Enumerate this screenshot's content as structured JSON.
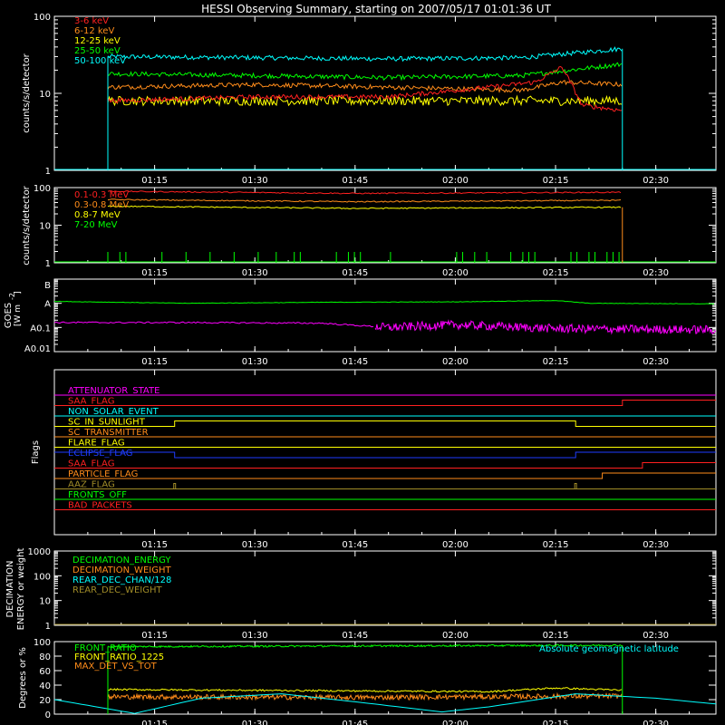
{
  "title": "HESSI Observing Summary, starting on 2007/05/17 01:01:36 UT",
  "time_ticks": [
    "01:15",
    "01:30",
    "01:45",
    "02:00",
    "02:15",
    "02:30"
  ],
  "colors": {
    "background": "#000000",
    "axes": "#ffffff",
    "red": "#ff2020",
    "orange": "#ff8c1a",
    "yellow": "#ffff00",
    "green": "#00ff00",
    "cyan": "#00ffff",
    "magenta": "#ff00ff",
    "blue": "#1e3cff",
    "olive": "#a08c28"
  },
  "chart_data": [
    {
      "type": "line",
      "name": "low-energy-rates",
      "ylabel": "counts/s/detector",
      "yscale": "log",
      "ylim": [
        1,
        100
      ],
      "ytick_labels": [
        "1",
        "10",
        "100"
      ],
      "legend": "top-left",
      "series": [
        {
          "name": "3-6 keV",
          "color": "#ff2020",
          "x": [
            "01:08",
            "01:30",
            "01:50",
            "02:05",
            "02:12",
            "02:16",
            "02:19",
            "02:25"
          ],
          "values": [
            8,
            9,
            9,
            12,
            14,
            22,
            7,
            6
          ]
        },
        {
          "name": "6-12 keV",
          "color": "#ff8c1a",
          "x": [
            "01:08",
            "01:30",
            "01:50",
            "02:10",
            "02:16",
            "02:25"
          ],
          "values": [
            12,
            13,
            12,
            11,
            14,
            13
          ]
        },
        {
          "name": "12-25 keV",
          "color": "#ffff00",
          "x": [
            "01:08",
            "01:30",
            "01:50",
            "02:10",
            "02:25"
          ],
          "values": [
            8,
            8,
            8,
            8,
            8
          ]
        },
        {
          "name": "25-50 keV",
          "color": "#00ff00",
          "x": [
            "01:08",
            "01:30",
            "01:50",
            "02:10",
            "02:25"
          ],
          "values": [
            18,
            17,
            16,
            17,
            24
          ]
        },
        {
          "name": "50-100 keV",
          "color": "#00ffff",
          "x": [
            "01:08",
            "01:30",
            "01:50",
            "02:10",
            "02:25"
          ],
          "values": [
            30,
            29,
            28,
            29,
            38
          ]
        }
      ]
    },
    {
      "type": "line",
      "name": "high-energy-rates",
      "ylabel": "counts/s/detector",
      "yscale": "log",
      "ylim": [
        1,
        100
      ],
      "ytick_labels": [
        "1",
        "10",
        "100"
      ],
      "legend": "top-left",
      "series": [
        {
          "name": "0.1-0.3 MeV",
          "color": "#ff2020",
          "x": [
            "01:08",
            "01:45",
            "02:25"
          ],
          "values": [
            80,
            70,
            75
          ]
        },
        {
          "name": "0.3-0.8 MeV",
          "color": "#ff8c1a",
          "x": [
            "01:08",
            "01:45",
            "02:25"
          ],
          "values": [
            48,
            42,
            46
          ]
        },
        {
          "name": "0.8-7 MeV",
          "color": "#ffff00",
          "x": [
            "01:08",
            "01:45",
            "02:25"
          ],
          "values": [
            32,
            28,
            30
          ]
        },
        {
          "name": "7-20 MeV",
          "color": "#00ff00",
          "x": [
            "01:08",
            "01:45",
            "02:25"
          ],
          "values": [
            1,
            1,
            1
          ]
        }
      ]
    },
    {
      "type": "line",
      "name": "goes",
      "ylabel": "GOES",
      "ylabel_lines": [
        "GOES",
        "[W m",
        "-2",
        "]"
      ],
      "yscale": "log",
      "ylim": [
        1e-09,
        1e-06
      ],
      "ytick_labels": [
        "A0.01",
        "A0.1",
        "A",
        "B"
      ],
      "series": [
        {
          "name": "goes-long",
          "color": "#00ff00",
          "x": [
            "01:00",
            "01:20",
            "01:40",
            "02:00",
            "02:15",
            "02:20",
            "02:39"
          ],
          "values": [
            1.2e-07,
            1e-07,
            1.1e-07,
            1.15e-07,
            1.3e-07,
            1e-07,
            9.5e-08
          ]
        },
        {
          "name": "goes-short",
          "color": "#ff00ff",
          "x": [
            "01:00",
            "01:20",
            "01:40",
            "01:50",
            "02:00",
            "02:15",
            "02:39"
          ],
          "values": [
            1.6e-08,
            1.6e-08,
            1.5e-08,
            1e-08,
            1.3e-08,
            9e-09,
            8e-09
          ]
        }
      ]
    },
    {
      "type": "step",
      "name": "flags",
      "ylabel": "Flags",
      "flags": [
        {
          "name": "ATTENUATOR_STATE",
          "color": "#ff00ff",
          "steps": []
        },
        {
          "name": "SAA_FLAG",
          "color": "#ff2020",
          "steps": [
            [
              "02:25",
              1
            ]
          ]
        },
        {
          "name": "NON_SOLAR_EVENT",
          "color": "#00ffff",
          "steps": []
        },
        {
          "name": "SC_IN_SUNLIGHT",
          "color": "#ffff00",
          "steps": [
            [
              "01:18",
              1
            ],
            [
              "02:18",
              0
            ]
          ]
        },
        {
          "name": "SC_TRANSMITTER",
          "color": "#ff8c1a",
          "steps": []
        },
        {
          "name": "FLARE_FLAG",
          "color": "#ffff00",
          "steps": []
        },
        {
          "name": "ECLIPSE_FLAG",
          "color": "#1e3cff",
          "steps": [
            [
              "01:18",
              0
            ],
            [
              "02:18",
              1
            ]
          ]
        },
        {
          "name": "SAA_FLAG",
          "color": "#ff2020",
          "steps": [
            [
              "02:28",
              1
            ]
          ]
        },
        {
          "name": "PARTICLE_FLAG",
          "color": "#ff8c1a",
          "steps": [
            [
              "02:22",
              1
            ]
          ]
        },
        {
          "name": "AAZ_FLAG",
          "color": "#a08c28",
          "steps": []
        },
        {
          "name": "FRONTS_OFF",
          "color": "#00ff00",
          "steps": []
        },
        {
          "name": "BAD_PACKETS",
          "color": "#ff2020",
          "steps": []
        }
      ]
    },
    {
      "type": "line",
      "name": "decimation",
      "ylabel_lines": [
        "DECIMATION",
        "ENERGY or weight"
      ],
      "yscale": "log",
      "ylim": [
        1,
        1000
      ],
      "ytick_labels": [
        "1",
        "10",
        "100",
        "1000"
      ],
      "legend": "top-left",
      "series": [
        {
          "name": "DECIMATION_ENERGY",
          "color": "#00ff00",
          "x": [
            "01:00",
            "02:39"
          ],
          "values": [
            1,
            1
          ]
        },
        {
          "name": "DECIMATION_WEIGHT",
          "color": "#ff8c1a",
          "x": [
            "01:00",
            "02:39"
          ],
          "values": [
            1,
            1
          ]
        },
        {
          "name": "REAR_DEC_CHAN/128",
          "color": "#00ffff",
          "x": [
            "01:00",
            "02:39"
          ],
          "values": [
            1,
            1
          ]
        },
        {
          "name": "REAR_DEC_WEIGHT",
          "color": "#a08c28",
          "x": [
            "01:00",
            "02:39"
          ],
          "values": [
            1,
            1
          ]
        }
      ]
    },
    {
      "type": "line",
      "name": "ratios",
      "ylabel": "Degrees or %",
      "ylim": [
        0,
        100
      ],
      "ytick_labels": [
        "0",
        "20",
        "40",
        "60",
        "80",
        "100"
      ],
      "legend": "top-left",
      "series": [
        {
          "name": "FRONT_RATIO",
          "color": "#00ff00",
          "x": [
            "01:08",
            "01:45",
            "02:25"
          ],
          "values": [
            93,
            94,
            95
          ]
        },
        {
          "name": "FRONT_RATIO_1225",
          "color": "#ffff00",
          "x": [
            "01:08",
            "01:45",
            "02:05",
            "02:15",
            "02:25"
          ],
          "values": [
            34,
            32,
            31,
            36,
            33
          ]
        },
        {
          "name": "MAX_DET_VS_TOT",
          "color": "#ff8c1a",
          "x": [
            "01:08",
            "01:45",
            "02:05",
            "02:25"
          ],
          "values": [
            24,
            23,
            24,
            25
          ]
        },
        {
          "name": "Absolute geomagnetic latitude",
          "color": "#00ffff",
          "x": [
            "01:00",
            "01:12",
            "01:22",
            "01:34",
            "01:46",
            "01:58",
            "02:05",
            "02:18",
            "02:30",
            "02:39"
          ],
          "values": [
            20,
            1,
            22,
            28,
            16,
            3,
            10,
            28,
            22,
            14
          ]
        }
      ]
    }
  ]
}
